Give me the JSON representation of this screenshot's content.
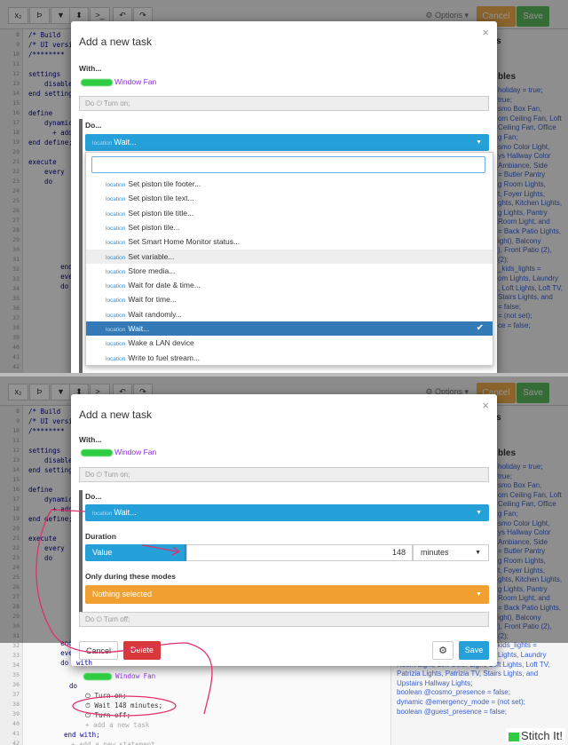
{
  "toolbar": {
    "buttons": [
      {
        "label": "x₂"
      },
      {
        "label": "Þ"
      },
      {
        "label": "▼"
      },
      {
        "label": "⬍"
      },
      {
        "label": ">_"
      },
      {
        "label": "↶"
      },
      {
        "label": "↷"
      }
    ],
    "options_label": "⚙ Options ▾",
    "cancel_label": "Cancel",
    "save_label": "Save"
  },
  "editor": {
    "line_numbers_top": [
      "8",
      "9",
      "10",
      "11",
      "12",
      "13",
      "14",
      "15",
      "16",
      "17",
      "18",
      "19",
      "20",
      "21",
      "22",
      "23",
      "24",
      "25",
      "26",
      "27",
      "28",
      "29",
      "30",
      "31",
      "32",
      "33",
      "34",
      "35",
      "36",
      "37",
      "38",
      "39",
      "40",
      "41",
      "42"
    ],
    "line_numbers_bottom": [
      "8",
      "9",
      "10",
      "11",
      "12",
      "13",
      "14",
      "15",
      "16",
      "17",
      "18",
      "19",
      "20",
      "21",
      "22",
      "23",
      "24",
      "25",
      "26",
      "27",
      "28",
      "29",
      "30",
      "31",
      "32",
      "33",
      "34",
      "35",
      "36",
      "37",
      "38",
      "39",
      "40",
      "41",
      "42"
    ],
    "code_top": [
      "/* Build",
      "/* UI versi",
      "/********",
      "",
      "settings",
      "    disable",
      "end setting",
      "",
      "define",
      "    dynamic",
      "      + add",
      "end define;",
      "",
      "execute",
      "    every",
      "    do"
    ],
    "code_top_lower": [
      "        end ev",
      "        every",
      "        do"
    ],
    "code_bottom_lines": [
      "/* Build",
      "/* UI versi",
      "/********",
      "",
      "settings",
      "    disable",
      "end setting",
      "",
      "define",
      "    dynamic",
      "      + add",
      "end define;",
      "",
      "execute",
      "    every",
      "    do"
    ],
    "code_bottom_lower": [
      "        end ev",
      "        every",
      "        do"
    ],
    "bottom_with": "with",
    "bottom_device": "Window Fan",
    "bottom_do": "do",
    "bottom_turn_on": "⏻ Turn on;",
    "bottom_wait": "⏱ Wait 148 minutes;",
    "bottom_turn_off": "⏻ Turn off;",
    "bottom_add": "+ add a new task",
    "bottom_end_with": "end with;",
    "bottom_add2": "+ add a new statement"
  },
  "right_side": {
    "header_top": "s",
    "header_vars": "bles",
    "lines_top": [
      "holiday = true;",
      "true;",
      "smo Box Fan,",
      "om Ceiling Fan, Loft",
      "Ceiling Fan, Office",
      "g Fan;",
      "smo Color Light,",
      "ys Hallway Color",
      "Ambiance, Side",
      "= Butler Pantry",
      "g Room Lights,",
      "t, Foyer Lights,",
      "ghts, Kitchen Lights,",
      "g Lights, Pantry",
      "Room Light, and",
      "= Back Patio Lights,",
      "ight), Balcony",
      "), Front Patio (2),",
      "(2);",
      "_kids_lights =",
      "om Lights, Laundry",
      ", Loft Lights, Loft TV,",
      "Stairs Lights, and",
      "= false;",
      "= (not set);",
      "ce = false;"
    ],
    "lines_bottom": [
      "holiday = true;",
      "true;",
      "smo Box Fan,",
      "om Ceiling Fan, Loft",
      "Ceiling Fan, Office",
      "g Fan;",
      "smo Color Light,",
      "ys Hallway Color",
      "Ambiance, Side",
      "= Butler Pantry",
      "g Room Lights,",
      "t, Foyer Lights,",
      "ghts, Kitchen Lights,",
      "g Lights, Pantry",
      "Room Light, and",
      "= Back Patio Lights,",
      "ight), Balcony",
      "), Front Patio (2),",
      "(2);",
      "device @all_upstairs_common_kids_lights =",
      "Gennaro Lights, Kids Bathroom Lights, Laundry",
      "Room Light, Loft Color Light, Loft Lights, Loft TV,",
      "Patrizia Lights, Patrizia TV, Stairs Lights, and",
      "Upstairs Hallway Lights;",
      "boolean @cosmo_presence = false;",
      "dynamic @emergency_mode = (not set);",
      "boolean @guest_presence = false;"
    ]
  },
  "modal": {
    "title": "Add a new task",
    "close": "×",
    "with_label": "With...",
    "device": "Window Fan",
    "turn_on_row": "Do ⏻ Turn on;",
    "do_label": "Do...",
    "selected_small": "location",
    "selected_value": "Wait...",
    "dropdown_items": [
      {
        "loc": "location",
        "label": "Set piston tile footer..."
      },
      {
        "loc": "location",
        "label": "Set piston tile text..."
      },
      {
        "loc": "location",
        "label": "Set piston tile title..."
      },
      {
        "loc": "location",
        "label": "Set piston tile..."
      },
      {
        "loc": "location",
        "label": "Set Smart Home Monitor status..."
      },
      {
        "loc": "location",
        "label": "Set variable..."
      },
      {
        "loc": "location",
        "label": "Store media..."
      },
      {
        "loc": "location",
        "label": "Wait for date & time..."
      },
      {
        "loc": "location",
        "label": "Wait for time..."
      },
      {
        "loc": "location",
        "label": "Wait randomly..."
      },
      {
        "loc": "location",
        "label": "Wait..."
      },
      {
        "loc": "location",
        "label": "Wake a LAN device"
      },
      {
        "loc": "location",
        "label": "Write to fuel stream..."
      }
    ],
    "highlighted_index": 5,
    "selected_index": 10,
    "duration_label": "Duration",
    "duration_mode": "Value",
    "duration_value": "148",
    "duration_unit": "minutes",
    "modes_label": "Only during these modes",
    "modes_value": "Nothing selected",
    "turn_off_row": "Do ⏻ Turn off;",
    "cancel_label": "Cancel",
    "delete_label": "Delete",
    "gear": "⚙",
    "save_label": "Save"
  },
  "watermark": "Stitch It!",
  "colors": {
    "blue": "#26a0d9",
    "orange": "#f0a030",
    "delete_red": "#d9383a",
    "green_save": "#5cb85c",
    "cancel_orange": "#f0ad4e",
    "annotation": "#e0306a"
  }
}
